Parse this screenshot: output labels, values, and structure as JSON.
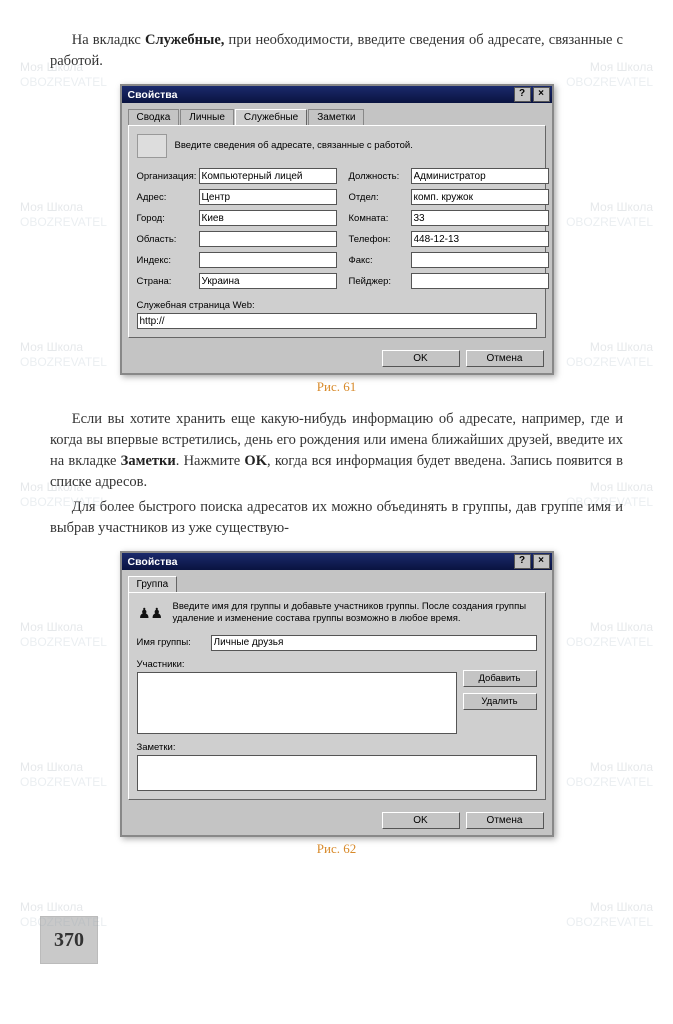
{
  "text": {
    "p1a": "На вкладкс ",
    "p1b": "Служебные,",
    "p1c": " при необходимости, введите сведения об адресате, связанные с работой.",
    "p2a": "Если вы хотите хранить еще какую-нибудь информацию об адресате, например, где и когда вы впервые встретились, день его рождения или имена ближайших друзей, введите их на вкладке ",
    "p2b": "Заметки",
    "p2c": ". Нажмите ",
    "p2d": "OK",
    "p2e": ", когда вся информация будет введена. Запись появится в списке адресов.",
    "p3": "Для более быстрого поиска адресатов их можно объединять в группы, дав группе имя и выбрав участников из уже существую-"
  },
  "captions": {
    "fig61": "Рис. 61",
    "fig62": "Рис. 62"
  },
  "dialog1": {
    "title": "Свойства",
    "tabs": {
      "t1": "Сводка",
      "t2": "Личные",
      "t3": "Служебные",
      "t4": "Заметки"
    },
    "hint": "Введите сведения об адресате, связанные с работой.",
    "labels": {
      "org": "Организация:",
      "addr": "Адрес:",
      "city": "Город:",
      "region": "Область:",
      "index": "Индекс:",
      "country": "Страна:",
      "pos": "Должность:",
      "dept": "Отдел:",
      "room": "Комната:",
      "phone": "Телефон:",
      "fax": "Факс:",
      "pager": "Пейджер:",
      "web": "Служебная страница Web:"
    },
    "values": {
      "org": "Компьютерный лицей",
      "addr": "Центр",
      "city": "Киев",
      "region": "",
      "index": "",
      "country": "Украина",
      "pos": "Администратор",
      "dept": "комп. кружок",
      "room": "33",
      "phone": "448-12-13",
      "fax": "",
      "pager": "",
      "web": "http://"
    },
    "buttons": {
      "ok": "OK",
      "cancel": "Отмена"
    }
  },
  "dialog2": {
    "title": "Свойства",
    "tabs": {
      "t1": "Группа"
    },
    "hint": "Введите имя для группы и добавьте участников группы. После создания группы удаление и изменение состава группы возможно в любое время.",
    "labels": {
      "name": "Имя группы:",
      "members": "Участники:",
      "notes": "Заметки:"
    },
    "values": {
      "name": "Личные друзья"
    },
    "buttons": {
      "add": "Добавить",
      "remove": "Удалить",
      "ok": "OK",
      "cancel": "Отмена"
    }
  },
  "page_number": "370",
  "watermark": {
    "left": "Моя Школа",
    "right": "OBOZREVATEL"
  }
}
